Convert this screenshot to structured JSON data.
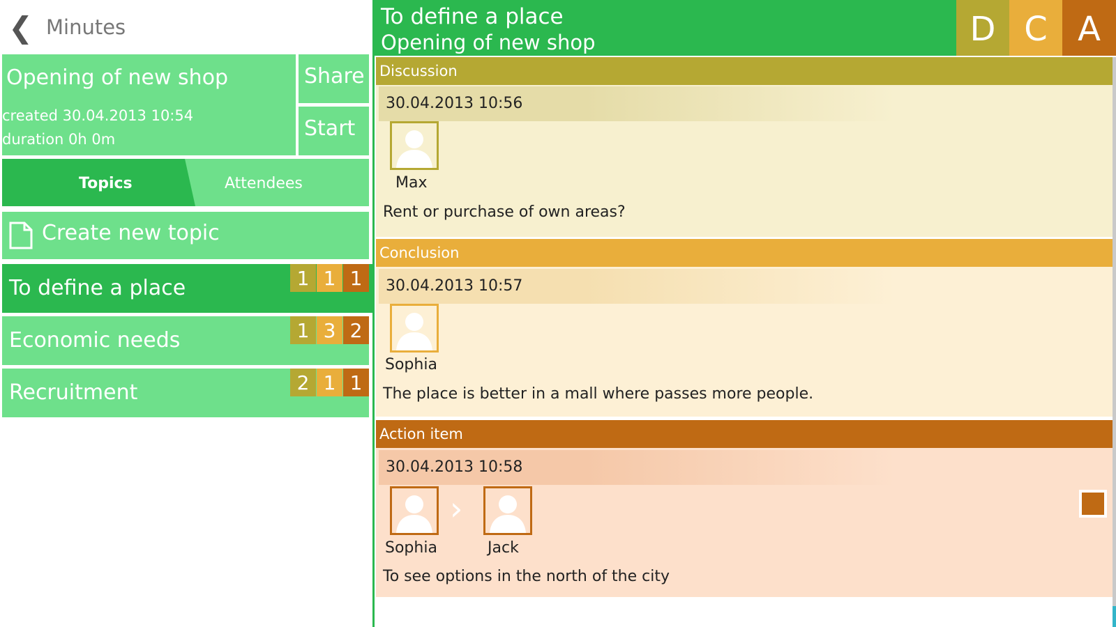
{
  "header": {
    "back_icon": "chevron-left-icon",
    "title": "Minutes"
  },
  "meeting": {
    "title": "Opening of new shop",
    "created": "created 30.04.2013 10:54",
    "duration": "duration 0h 0m",
    "share_label": "Share",
    "start_label": "Start"
  },
  "tabs": [
    {
      "label": "Topics",
      "active": true
    },
    {
      "label": "Attendees",
      "active": false
    }
  ],
  "create_topic": {
    "icon": "document-icon",
    "label": "Create new topic"
  },
  "topics": [
    {
      "label": "To define a place",
      "selected": true,
      "counts": [
        "1",
        "1",
        "1"
      ]
    },
    {
      "label": "Economic needs",
      "selected": false,
      "counts": [
        "1",
        "3",
        "2"
      ]
    },
    {
      "label": "Recruitment",
      "selected": false,
      "counts": [
        "2",
        "1",
        "1"
      ]
    }
  ],
  "detail": {
    "topic_title": "To define a place",
    "meeting_title": "Opening of new shop",
    "type_buttons": [
      {
        "label": "D",
        "color": "#b5a833"
      },
      {
        "label": "C",
        "color": "#e9ae3b"
      },
      {
        "label": "A",
        "color": "#bf6a14"
      }
    ],
    "sections": [
      {
        "title": "Discussion",
        "header_color": "#b5a833",
        "body_color": "#f7f0cf",
        "date": "30.04.2013 10:56",
        "people": [
          "Max"
        ],
        "text": "Rent or purchase of own areas?"
      },
      {
        "title": "Conclusion",
        "header_color": "#e9ae3b",
        "body_color": "#fdf0d5",
        "date": "30.04.2013 10:57",
        "people": [
          "Sophia"
        ],
        "text": "The place is better in a mall where passes more people."
      },
      {
        "title": "Action item",
        "header_color": "#bf6a14",
        "body_color": "#fde0cb",
        "date": "30.04.2013 10:58",
        "people": [
          "Sophia",
          "Jack"
        ],
        "arrow": "›",
        "text": "To see options in the north of the city"
      }
    ]
  },
  "colors": {
    "dark_green": "#2bb84f",
    "light_green": "#6ee08b"
  }
}
